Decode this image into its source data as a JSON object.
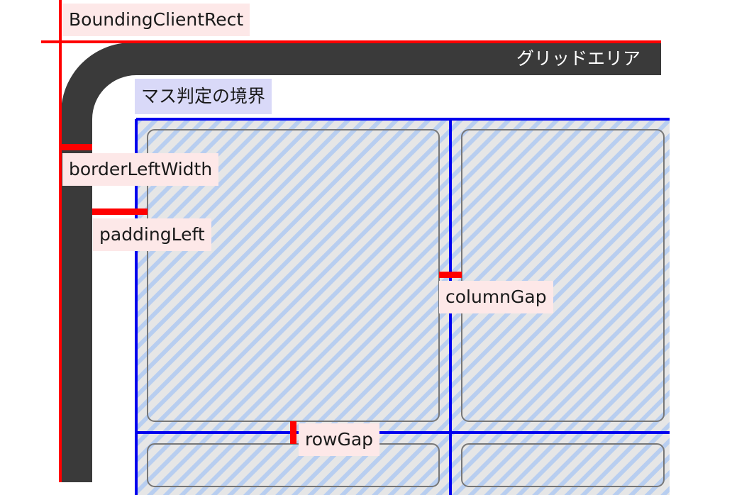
{
  "labels": {
    "bounding_client_rect": "BoundingClientRect",
    "grid_area": "グリッドエリア",
    "cell_boundary": "マス判定の境界",
    "border_left_width": "borderLeftWidth",
    "padding_left": "paddingLeft",
    "column_gap": "columnGap",
    "row_gap": "rowGap"
  },
  "colors": {
    "bounding_line": "#ff0000",
    "border_fill": "#3a3a3a",
    "cell_boundary_line": "#0000ee",
    "cell_fill": "#e6e6e6",
    "cell_stripe": "#b8cef0",
    "cell_outline": "#777777",
    "label_bg_red": "#fde8e8",
    "label_bg_blue": "#d9d9f8"
  }
}
